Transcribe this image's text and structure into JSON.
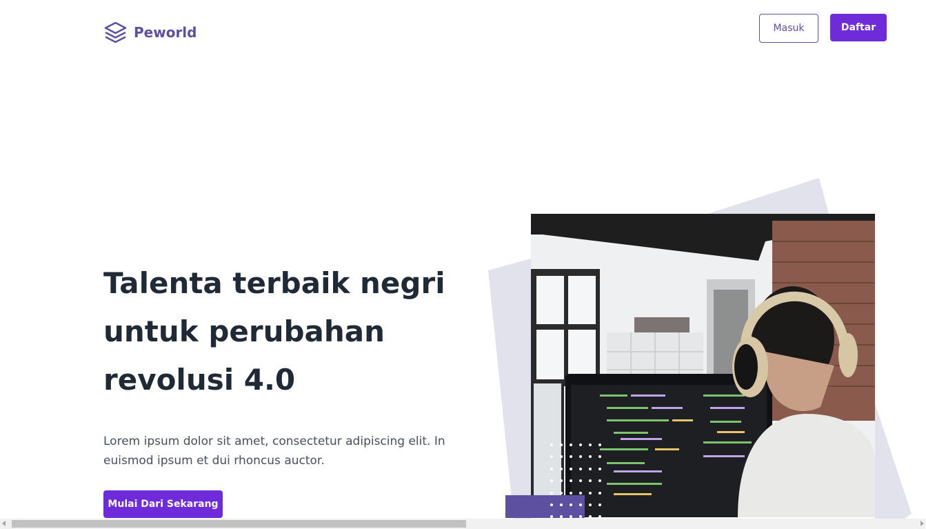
{
  "nav": {
    "brand": "Peworld",
    "logo_icon": "layers-icon",
    "login_label": "Masuk",
    "register_label": "Daftar"
  },
  "hero": {
    "title": "Talenta terbaik negri untuk perubahan revolusi 4.0",
    "description": "Lorem ipsum dolor sit amet, consectetur adipiscing elit. In euismod ipsum et dui rhoncus auctor.",
    "cta_label": "Mulai Dari Sekarang",
    "image_subject": "developer-with-headphones-at-computer"
  },
  "colors": {
    "brand": "#5e50a1",
    "accent": "#6f2bd9",
    "heading": "#1f2a36",
    "deco": "#e2e2ec"
  }
}
